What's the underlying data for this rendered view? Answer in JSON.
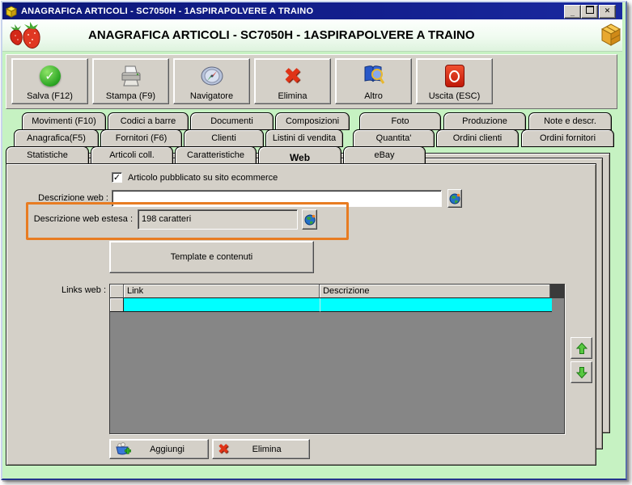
{
  "window": {
    "title": "ANAGRAFICA ARTICOLI - SC7050H - 1ASPIRAPOLVERE A TRAINO",
    "app_icon": "yellow-box"
  },
  "titlebar": {
    "minimize": "_",
    "maximize": "❒",
    "close": "✕"
  },
  "header": {
    "title": "ANAGRAFICA ARTICOLI - SC7050H - 1ASPIRAPOLVERE A TRAINO",
    "left_icon": "strawberries-icon",
    "right_icon": "package-icon"
  },
  "toolbar": {
    "buttons": [
      {
        "label": "Salva (F12)",
        "icon": "save-check-icon"
      },
      {
        "label": "Stampa (F9)",
        "icon": "printer-icon"
      },
      {
        "label": "Navigatore",
        "icon": "compass-icon"
      },
      {
        "label": "Elimina",
        "icon": "red-x-icon"
      },
      {
        "label": "Altro",
        "icon": "book-magnifier-icon"
      },
      {
        "label": "Uscita (ESC)",
        "icon": "power-icon"
      }
    ]
  },
  "tabs": {
    "row1": [
      "Movimenti (F10)",
      "Codici a barre",
      "Documenti",
      "Composizioni",
      "Foto",
      "Produzione",
      "Note e descr."
    ],
    "row2": [
      "Anagrafica(F5)",
      "Fornitori (F6)",
      "Clienti",
      "Listini di vendita",
      "Quantita'",
      "Ordini clienti",
      "Ordini fornitori"
    ],
    "row3": [
      "Statistiche",
      "Articoli coll.",
      "Caratteristiche",
      "Web",
      "eBay"
    ],
    "active_tab": "Web"
  },
  "web_tab": {
    "publish_checkbox": {
      "label": "Articolo pubblicato su sito ecommerce",
      "checked": true
    },
    "descrizione_web": {
      "label": "Descrizione web :",
      "value": "",
      "icon": "globe-icon"
    },
    "descrizione_web_estesa": {
      "label": "Descrizione web estesa :",
      "value": "198 caratteri",
      "icon": "globe-icon"
    },
    "template_button": "Template e contenuti",
    "links_web": {
      "label": "Links web :",
      "columns": [
        "",
        "Link",
        "Descrizione"
      ],
      "rows": [
        {
          "link": "",
          "descrizione": ""
        }
      ]
    },
    "move_up_button": "up-arrow",
    "move_down_button": "down-arrow",
    "aggiungi_button": "Aggiungi",
    "elimina_button": "Elimina"
  },
  "icons": {
    "check": "✓",
    "red_x": "✖",
    "plus": "+"
  },
  "colors": {
    "titlebar_blue": "#131f8e",
    "window_green": "#c6f2c2",
    "panel_gray": "#d4d0c8",
    "grid_empty_gray": "#868686",
    "selected_row_cyan": "#00ffff",
    "annotation_orange": "#e87c22"
  }
}
